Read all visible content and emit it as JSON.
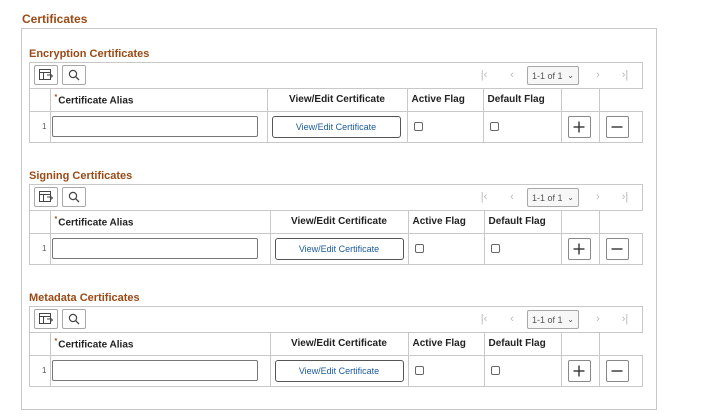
{
  "page": {
    "title": "Certificates"
  },
  "sections": [
    {
      "title": "Encryption Certificates",
      "pagination": "1-1 of 1",
      "columns": {
        "alias": "Certificate Alias",
        "view_edit": "View/Edit Certificate",
        "active": "Active Flag",
        "default": "Default Flag"
      },
      "rows": [
        {
          "num": "1",
          "alias_value": "",
          "view_edit_label": "View/Edit Certificate",
          "active_checked": false,
          "default_checked": false
        }
      ]
    },
    {
      "title": "Signing Certificates",
      "pagination": "1-1 of 1",
      "columns": {
        "alias": "Certificate Alias",
        "view_edit": "View/Edit Certificate",
        "active": "Active Flag",
        "default": "Default Flag"
      },
      "rows": [
        {
          "num": "1",
          "alias_value": "",
          "view_edit_label": "View/Edit Certificate",
          "active_checked": false,
          "default_checked": false
        }
      ]
    },
    {
      "title": "Metadata Certificates",
      "pagination": "1-1 of 1",
      "columns": {
        "alias": "Certificate Alias",
        "view_edit": "View/Edit Certificate",
        "active": "Active Flag",
        "default": "Default Flag"
      },
      "rows": [
        {
          "num": "1",
          "alias_value": "",
          "view_edit_label": "View/Edit Certificate",
          "active_checked": false,
          "default_checked": false
        }
      ]
    }
  ],
  "icons": {
    "personalize": "grid-personalize-icon",
    "find": "search-icon",
    "first": "first-page-icon",
    "prev": "previous-page-icon",
    "next": "next-page-icon",
    "last": "last-page-icon",
    "add": "plus-icon",
    "delete": "minus-icon"
  },
  "colors": {
    "section_title": "#9a4a14",
    "link": "#1a5a9a",
    "border": "#c8c8c8"
  }
}
